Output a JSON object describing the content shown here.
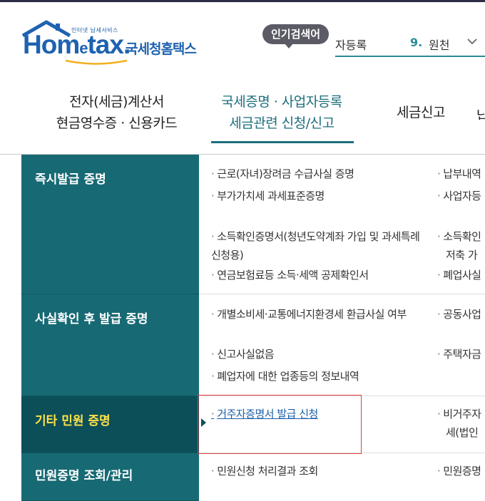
{
  "header": {
    "logo": {
      "tagline": "인터넷 납세서비스",
      "wordmark_prefix": "Hom",
      "wordmark_e": "e",
      "wordmark_suffix": "tax.",
      "korean_name": "국세청홈택스"
    },
    "popular_search": {
      "badge": "인기검색어",
      "previous_partial": "자등록",
      "rank": "9.",
      "term": "원천",
      "chevron_icon": "chevron-down-icon"
    }
  },
  "nav": {
    "items": [
      {
        "line1": "전자(세금)계산서",
        "line2": "현금영수증 · 신용카드"
      },
      {
        "line1": "국세증명 · 사업자등록",
        "line2": "세금관련 신청/신고",
        "active": true
      },
      {
        "line1": "세금신고"
      },
      {
        "line1": "납"
      }
    ]
  },
  "menu": {
    "categories": [
      {
        "label": "즉시발급 증명"
      },
      {
        "label": "사실확인 후 발급 증명"
      },
      {
        "label": "기타 민원 증명",
        "active": true
      },
      {
        "label": "민원증명 조회/관리"
      }
    ],
    "col1": [
      "근로(자녀)장려금 수급사실 증명",
      "부가가치세 과세표준증명",
      "소득확인증명서(청년도약계좌 가입 및 과세특례 신청용)",
      "연금보험료등 소득·세액 공제확인서",
      "개별소비세·교통에너지환경세 환급사실 여부",
      "신고사실없음",
      "폐업자에 대한 업종등의 정보내역",
      "거주자증명서 발급 신청",
      "민원신청 처리결과 조회"
    ],
    "col2": [
      "납부내역",
      "사업자등",
      "소득확인",
      "저축 가",
      "폐업사실",
      "공동사업",
      "주택자금",
      "비거주자",
      "세(법인",
      "민원증명"
    ],
    "bullet": "·"
  },
  "colors": {
    "primary": "#176a74",
    "active_category": "#0c4f59",
    "active_text": "#ffe24a",
    "highlight_border": "#e24040"
  }
}
